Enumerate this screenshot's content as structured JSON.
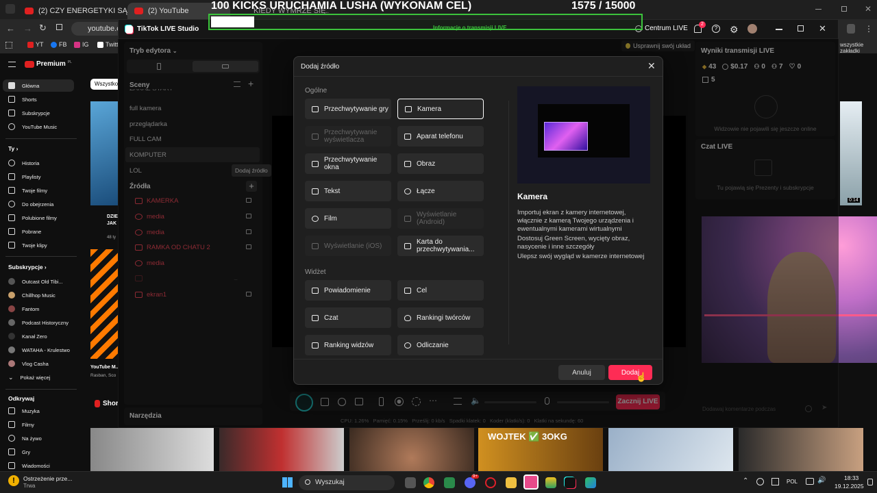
{
  "overlay": {
    "title": "100 KICKS URUCHAMIA LUSHA (WYKONAM CEL)",
    "counter": "1575 / 15000",
    "info": "Informacje o transmisji LIVE",
    "colors": {
      "green": "#3cc43c"
    }
  },
  "browser": {
    "tabs": [
      "(2) CZY ENERGETYKI SĄ SZKODLIWE...",
      "(2) YouTube",
      "KIEDY WYMRZE SIĘ..."
    ],
    "address": "youtube.com",
    "bookmarks": [
      "YT",
      "FB",
      "IG",
      "Twitt",
      "wszystkie zakładki"
    ],
    "live_center": "Centrum LIVE",
    "notif_count": "2",
    "improve": "Usprawnij swój układ"
  },
  "yt_sidebar": {
    "brand": "Premium",
    "brand_sup": "PL",
    "chip": "Wszystko",
    "main": [
      "Główna",
      "Shorts",
      "Subskrypcje",
      "YouTube Music"
    ],
    "you_header": "Ty",
    "you": [
      "Historia",
      "Playlisty",
      "Twoje filmy",
      "Do obejrzenia",
      "Polubione filmy",
      "Pobrane",
      "Twoje klipy"
    ],
    "subs_header": "Subskrypcje",
    "subs": [
      "Outcast Old Tibi...",
      "Chillhop Music",
      "Fantom",
      "Podcast Historyczny",
      "Kanał Zero",
      "WATAHA - Krulestwo",
      "Vlog Casha",
      "Pokaż więcej"
    ],
    "explore_header": "Odkrywaj",
    "explore": [
      "Muzyka",
      "Filmy",
      "Na żywo",
      "Gry",
      "Wiadomości"
    ],
    "shorts_label": "Shor",
    "video_title": "YouTube M...",
    "video_channel": "Rasban, Sco",
    "video_title2": "DZIE JAK",
    "video_meta": "48 ty"
  },
  "studio": {
    "app_title": "TikTok LIVE Studio",
    "mode": "Tryb edytora",
    "scenes_header": "Sceny",
    "scenes": [
      "ZAKAZ START",
      "full kamera",
      "przeglądarka",
      "FULL CAM",
      "KOMPUTER",
      "LOL"
    ],
    "tooltip": "Dodaj źródło",
    "sources_header": "Źródła",
    "sources": [
      "KAMERKA",
      "media",
      "media",
      "RAMKA OD CHATU 2",
      "media",
      "",
      "ekran1"
    ],
    "tools": "Narzędzia",
    "go_live": "Zacznij LIVE",
    "stats": "CPU: 1.26%   Pamięć: 0.15%   Prześlij: 0 kb/s   Spadki klatek: 0   Koder (klatki/s): 0   Klatki na sekundę: 60",
    "results_title": "Wyniki transmisji LIVE",
    "results": [
      "43",
      "$0.17",
      "0",
      "7",
      "0",
      "5"
    ],
    "no_viewers": "Widzowie nie pojawili się jeszcze online",
    "chat_title": "Czat LIVE",
    "chat_empty": "Tu pojawią się Prezenty i subskrypcje",
    "comment_placeholder": "Dodawaj komentarze podczas"
  },
  "modal": {
    "title": "Dodaj źródło",
    "general": "Ogólne",
    "options": [
      {
        "label": "Przechwytywanie gry",
        "icon": "gamepad-icon",
        "state": "normal"
      },
      {
        "label": "Kamera",
        "icon": "camera-icon",
        "state": "selected"
      },
      {
        "label": "Przechwytywanie wyświetlacza",
        "icon": "monitor-icon",
        "state": "disabled"
      },
      {
        "label": "Aparat telefonu",
        "icon": "phone-camera-icon",
        "state": "normal"
      },
      {
        "label": "Przechwytywanie okna",
        "icon": "window-icon",
        "state": "normal"
      },
      {
        "label": "Obraz",
        "icon": "image-icon",
        "state": "normal"
      },
      {
        "label": "Tekst",
        "icon": "text-icon",
        "state": "normal"
      },
      {
        "label": "Łącze",
        "icon": "globe-icon",
        "state": "normal"
      },
      {
        "label": "Film",
        "icon": "play-icon",
        "state": "normal"
      },
      {
        "label": "Wyświetlanie (Android)",
        "icon": "android-icon",
        "state": "disabled"
      },
      {
        "label": "Wyświetlanie (iOS)",
        "icon": "ios-icon",
        "state": "disabled"
      },
      {
        "label": "Karta do przechwytywania...",
        "icon": "capture-card-icon",
        "state": "normal"
      }
    ],
    "widget": "Widżet",
    "widgets": [
      {
        "label": "Powiadomienie",
        "icon": "bell-icon"
      },
      {
        "label": "Cel",
        "icon": "goal-icon"
      },
      {
        "label": "Czat",
        "icon": "chat-icon"
      },
      {
        "label": "Rankingi twórców",
        "icon": "flame-icon"
      },
      {
        "label": "Ranking widzów",
        "icon": "ranking-icon"
      },
      {
        "label": "Odliczanie",
        "icon": "timer-icon"
      }
    ],
    "preview_title": "Kamera",
    "preview_desc": [
      "Importuj ekran z kamery internetowej, włącznie z kamerą Twojego urządzenia i ewentualnymi kamerami wirtualnymi",
      "Dostosuj Green Screen, wycięty obraz, nasycenie i inne szczegóły",
      "Ulepsz swój wygląd w kamerze internetowej"
    ],
    "cancel": "Anuluj",
    "add": "Dodaj"
  },
  "taskbar": {
    "search": "Wyszukaj",
    "warning_title": "Ostrzeżenie prze...",
    "warning_sub": "Trwa",
    "lang": "POL",
    "time": "18:33",
    "date": "19.12.2025",
    "badge": "9+"
  },
  "thumb_label": "WOJTEK ✅ 3OKG",
  "duration": "0:14"
}
